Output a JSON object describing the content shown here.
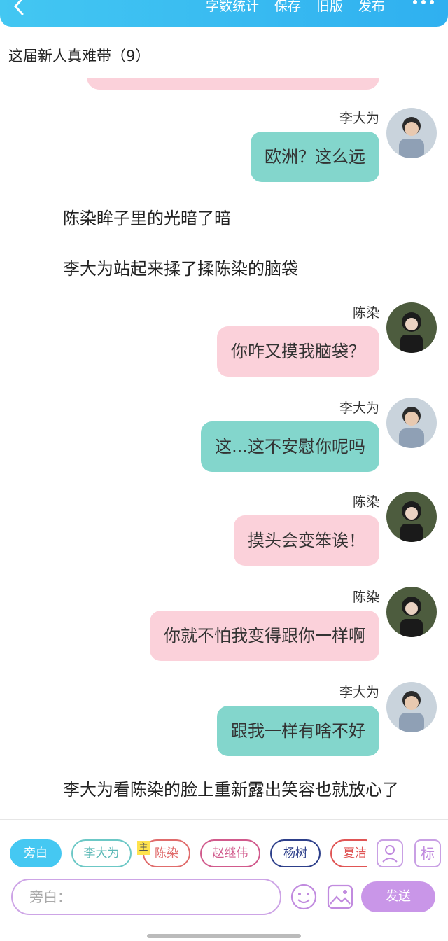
{
  "header": {
    "actions": [
      "字数统计",
      "保存",
      "旧版",
      "发布"
    ]
  },
  "title": "这届新人真难带（9）",
  "messages": [
    {
      "name": "李大为",
      "text": "欧洲？这么远",
      "color": "#83d6cc"
    },
    {
      "narration": "陈染眸子里的光暗了暗"
    },
    {
      "narration": "李大为站起来揉了揉陈染的脑袋"
    },
    {
      "name": "陈染",
      "text": "你咋又摸我脑袋？",
      "color": "#fbd1da"
    },
    {
      "name": "李大为",
      "text": "这...这不安慰你呢吗",
      "color": "#83d6cc"
    },
    {
      "name": "陈染",
      "text": "摸头会变笨诶！",
      "color": "#fbd1da"
    },
    {
      "name": "陈染",
      "text": "你就不怕我变得跟你一样啊",
      "color": "#fbd1da"
    },
    {
      "name": "李大为",
      "text": "跟我一样有啥不好",
      "color": "#83d6cc"
    },
    {
      "narration": "李大为看陈染的脸上重新露出笑容也就放心了"
    }
  ],
  "characters": [
    "旁白",
    "李大为",
    "陈染",
    "赵继伟",
    "杨树",
    "夏洁"
  ],
  "main_tag": "主",
  "buttons": {
    "mark": "标",
    "send": "发送"
  },
  "input": {
    "placeholder": "旁白："
  },
  "icons": [
    "back-icon",
    "more-icon",
    "person-icon",
    "emoji-icon",
    "image-icon"
  ]
}
